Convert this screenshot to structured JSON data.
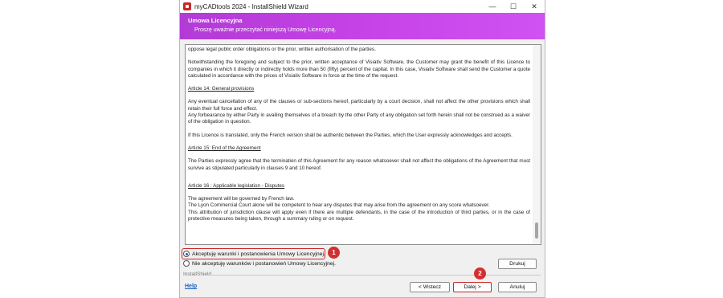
{
  "window": {
    "title": "myCADtools 2024 - InstallShield Wizard",
    "controls": {
      "minimize": "—",
      "maximize": "☐",
      "close": "✕"
    }
  },
  "header": {
    "title": "Umowa Licencyjna",
    "subtitle": "Proszę uważnie przeczytać niniejszą Umowę Licencyjną."
  },
  "license": {
    "paragraphs": [
      "oppose legal public order obligations or the prior, written authorisation of the parties.",
      "Notwithstanding the foregoing and subject to the prior, written acceptance of Visiativ Software, the Customer may grant the benefit of this Licence to companies in which it directly or indirectly holds more than 50 (fifty) percent of the capital. In this case, Visiativ Software shall send the Customer a quote calculated in accordance with the prices of Visiativ Software in force at the time of the request.",
      "Article 14: General provisions",
      "Any eventual cancellation of any of the clauses or sub-sections hereof, particularly by a court decision, shall not affect the other provisions which shall retain their full force and effect.\nAny forbearance by either Party in availing themselves of a breach by the other Party of any obligation set forth herein shall not be construed as a waiver of the obligation in question.",
      "If this Licence is translated, only the French version shall be authentic between the Parties, which the User expressly acknowledges and accepts.",
      "Article 15: End of the Agreement",
      "The Parties expressly agree that the termination of this Agreement for any reason whatsoever shall not affect the obligations of the Agreement that must survive as stipulated particularly in clauses 9 and 10 hereof.",
      "Article 16 : Applicable legislation - Disputes",
      "The agreement will be governed by French law.\nThe Lyon Commercial Court alone will be competent to hear any disputes that may arise from the agreement on any score whatsoever.\nThis attribution of jurisdiction clause will apply even if there are multiple defendants, in the case of the introduction of third parties, or in the case of protective measures being taken, through a summary ruling or on request."
    ]
  },
  "options": {
    "accept": "Akceptuję warunki i postanowienia Umowy Licencyjnej.",
    "decline": "Nie akceptuję warunków i postanowień Umowy Licencyjnej."
  },
  "buttons": {
    "print": "Drukuj",
    "back": "< Wstecz",
    "next": "Dalej >",
    "cancel": "Anuluj"
  },
  "footer": {
    "brand": "InstallShield",
    "help": "Help"
  },
  "callouts": {
    "one": "1",
    "two": "2"
  },
  "colors": {
    "header_gradient": "#c441e6",
    "callout": "#d32f2f",
    "highlight": "#c62828",
    "link": "#1f5fc4"
  }
}
